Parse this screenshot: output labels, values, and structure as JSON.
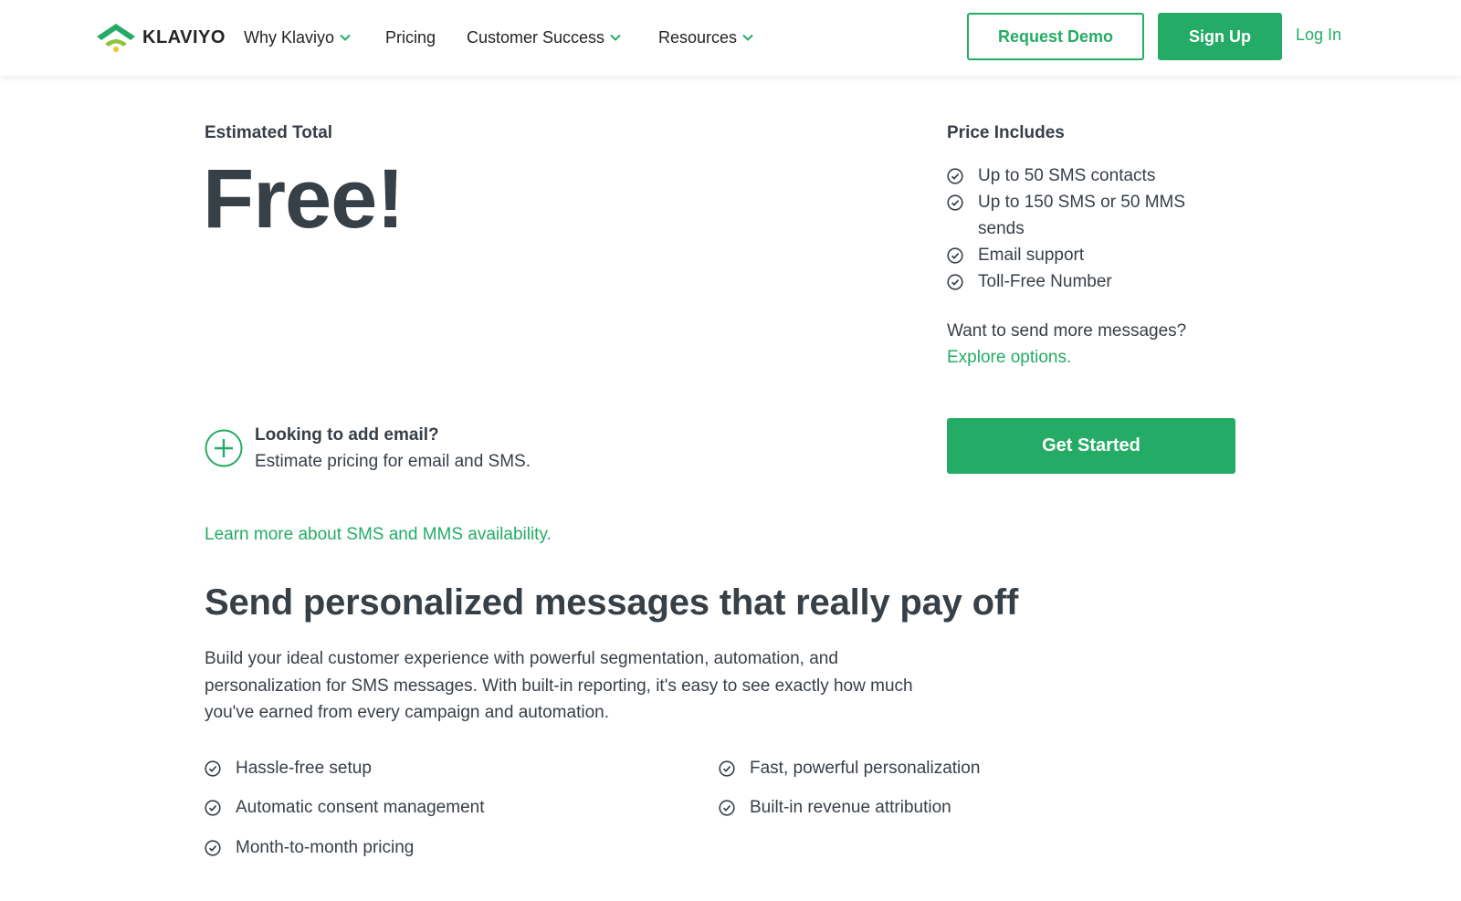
{
  "header": {
    "logo_text": "KLAVIYO",
    "nav": [
      {
        "label": "Why Klaviyo",
        "has_dropdown": true
      },
      {
        "label": "Pricing",
        "has_dropdown": false
      },
      {
        "label": "Customer Success",
        "has_dropdown": true
      },
      {
        "label": "Resources",
        "has_dropdown": true
      }
    ],
    "request_demo_label": "Request Demo",
    "sign_up_label": "Sign Up",
    "log_in_label": "Log In"
  },
  "estimate": {
    "label": "Estimated Total",
    "value": "Free!"
  },
  "includes": {
    "title": "Price Includes",
    "items": [
      "Up to 50 SMS contacts",
      "Up to 150 SMS or 50 MMS sends",
      "Email support",
      "Toll-Free Number"
    ],
    "more_question": "Want to send more messages?",
    "explore_link": "Explore options."
  },
  "add_email": {
    "title": "Looking to add email?",
    "subtitle": "Estimate pricing for email and SMS."
  },
  "get_started_label": "Get Started",
  "learn_more_link": "Learn more about SMS and MMS availability.",
  "section": {
    "headline": "Send personalized messages that really pay off",
    "paragraph": "Build your ideal customer experience with powerful segmentation, automation, and personalization for SMS messages. With built-in reporting, it's easy to see exactly how much you've earned from every campaign and automation.",
    "features_left": [
      "Hassle-free setup",
      "Automatic consent management",
      "Month-to-month pricing"
    ],
    "features_right": [
      "Fast, powerful personalization",
      "Built-in revenue attribution"
    ]
  },
  "colors": {
    "brand_green": "#24ac66",
    "text_dark": "#373f47"
  },
  "icons": [
    "klaviyo-logo-icon",
    "chevron-down-icon",
    "check-circle-icon",
    "plus-circle-icon"
  ]
}
